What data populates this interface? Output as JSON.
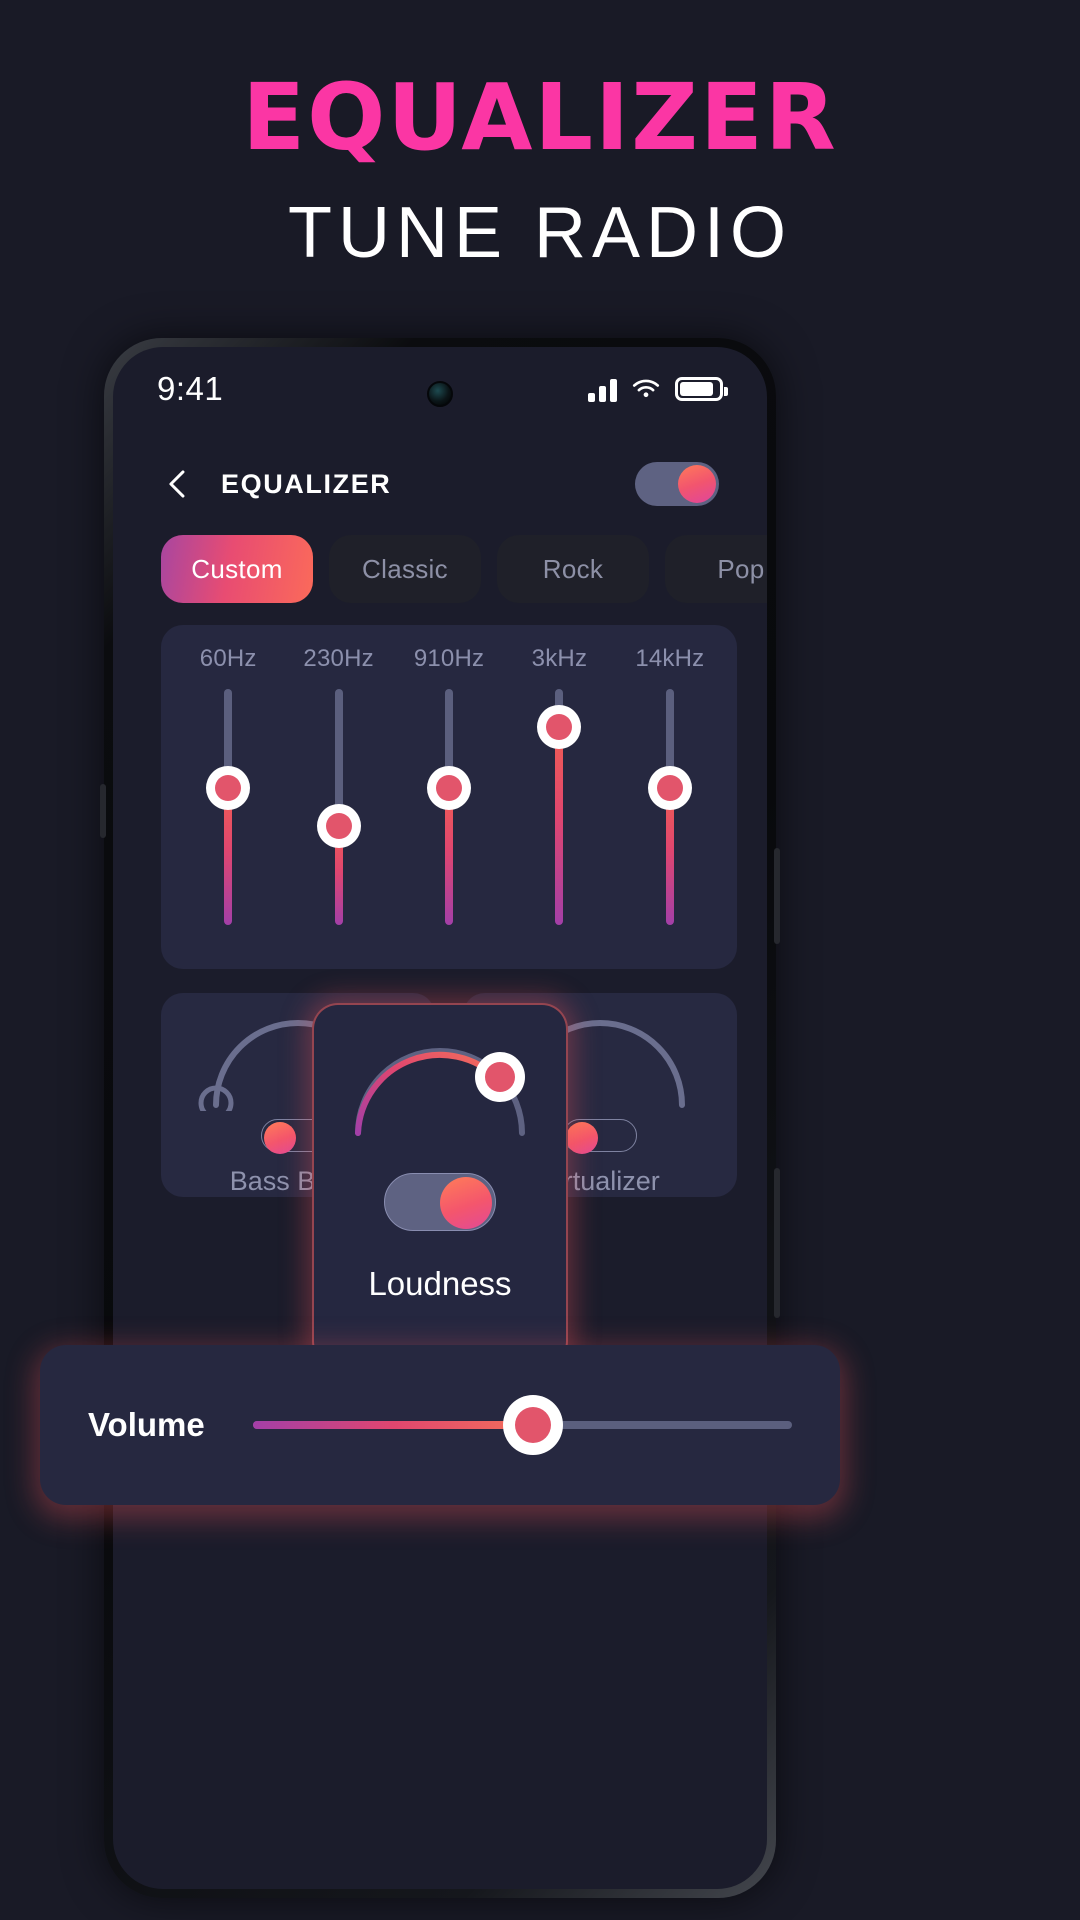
{
  "promo": {
    "title": "EQUALIZER",
    "subtitle": "TUNE RADIO",
    "title_color": "#fb36a4",
    "subtitle_color": "#ffffff"
  },
  "status_bar": {
    "time": "9:41",
    "icons": [
      "signal-icon",
      "wifi-icon",
      "battery-icon"
    ]
  },
  "app_header": {
    "back_icon": "chevron-left-icon",
    "title": "EQUALIZER",
    "master_toggle_state": "on"
  },
  "presets": {
    "items": [
      {
        "label": "Custom",
        "active": true
      },
      {
        "label": "Classic",
        "active": false
      },
      {
        "label": "Rock",
        "active": false
      },
      {
        "label": "Pop",
        "active": false
      },
      {
        "label": "",
        "active": false
      }
    ]
  },
  "equalizer": {
    "bands": [
      {
        "freq": "60Hz",
        "value": 58
      },
      {
        "freq": "230Hz",
        "value": 42
      },
      {
        "freq": "910Hz",
        "value": 58
      },
      {
        "freq": "3kHz",
        "value": 84
      },
      {
        "freq": "14kHz",
        "value": 58
      }
    ]
  },
  "effects": [
    {
      "label": "Bass Boost",
      "toggle_state": "on",
      "arc_value": 12
    },
    {
      "label": "Virtualizer",
      "toggle_state": "on",
      "arc_value": 12
    }
  ],
  "loudness": {
    "label": "Loudness",
    "toggle_state": "on",
    "arc_value": 72
  },
  "volume": {
    "label": "Volume",
    "value": 52
  },
  "colors": {
    "background": "#191a26",
    "panel": "#262840",
    "accent_pink": "#fb36a4",
    "accent_coral": "#f4566c",
    "accent_orange": "#ff7d58",
    "accent_purple": "#a846a0",
    "track_gray": "#5b5f7e",
    "muted_text": "#8c90ad"
  }
}
